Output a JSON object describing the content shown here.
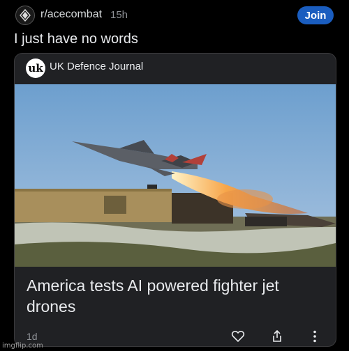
{
  "post": {
    "subreddit": "r/acecombat",
    "age": "15h",
    "join_label": "Join",
    "title": "I just have no words"
  },
  "card": {
    "source_logo_text": "uk",
    "source_name": "UK Defence Journal",
    "headline": "America tests AI powered fighter jet drones",
    "age": "1d",
    "image_icon": "drone-launch-photo",
    "actions": [
      "heart-icon",
      "share-icon",
      "more-icon"
    ]
  },
  "watermark": "imgflip.com"
}
